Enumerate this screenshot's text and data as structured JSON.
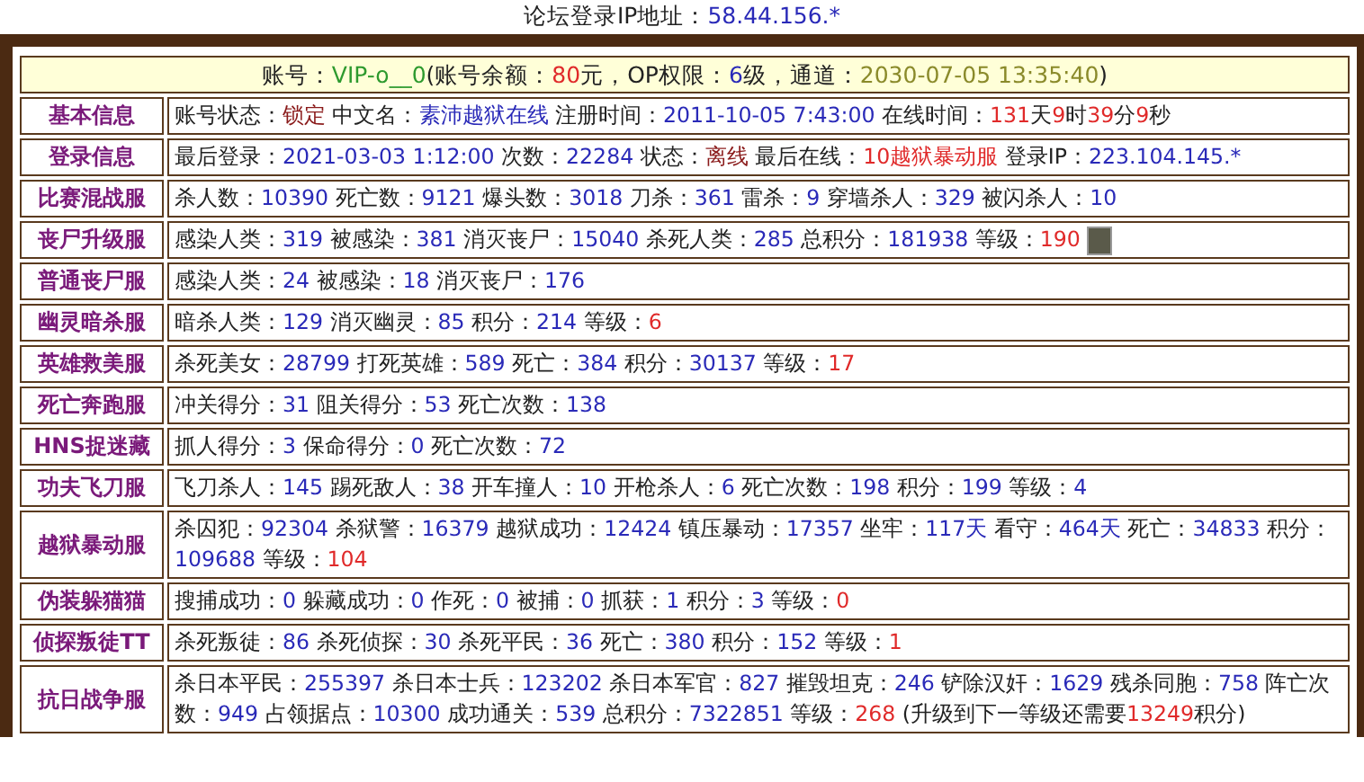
{
  "forum_ip": {
    "label": "论坛登录IP地址：",
    "value": "58.44.156.*"
  },
  "account_header": [
    {
      "text": "账号：",
      "kind": "plain"
    },
    {
      "text": "VIP-o__0",
      "kind": "account"
    },
    {
      "text": "(账号余额：",
      "kind": "plain"
    },
    {
      "text": "80",
      "kind": "level"
    },
    {
      "text": "元，OP权限：",
      "kind": "plain"
    },
    {
      "text": "6",
      "kind": "value"
    },
    {
      "text": "级，通道：",
      "kind": "plain"
    },
    {
      "text": "2030-07-05 13:35:40",
      "kind": "date"
    },
    {
      "text": ")",
      "kind": "plain"
    }
  ],
  "rows": [
    {
      "label": "基本信息",
      "parts": [
        {
          "text": "账号状态：",
          "kind": "plain"
        },
        {
          "text": "锁定",
          "kind": "status"
        },
        {
          "text": " 中文名：",
          "kind": "plain"
        },
        {
          "text": "素沛越狱在线",
          "kind": "value"
        },
        {
          "text": " 注册时间：",
          "kind": "plain"
        },
        {
          "text": "2011-10-05 7:43:00",
          "kind": "value"
        },
        {
          "text": " 在线时间：",
          "kind": "plain"
        },
        {
          "text": "131",
          "kind": "level"
        },
        {
          "text": "天",
          "kind": "plain"
        },
        {
          "text": "9",
          "kind": "level"
        },
        {
          "text": "时",
          "kind": "plain"
        },
        {
          "text": "39",
          "kind": "level"
        },
        {
          "text": "分",
          "kind": "plain"
        },
        {
          "text": "9",
          "kind": "level"
        },
        {
          "text": "秒",
          "kind": "plain"
        }
      ]
    },
    {
      "label": "登录信息",
      "parts": [
        {
          "text": "最后登录：",
          "kind": "plain"
        },
        {
          "text": "2021-03-03 1:12:00",
          "kind": "value"
        },
        {
          "text": " 次数：",
          "kind": "plain"
        },
        {
          "text": "22284",
          "kind": "value"
        },
        {
          "text": " 状态：",
          "kind": "plain"
        },
        {
          "text": "离线",
          "kind": "status"
        },
        {
          "text": " 最后在线：",
          "kind": "plain"
        },
        {
          "text": "10越狱暴动服",
          "kind": "level"
        },
        {
          "text": " 登录IP：",
          "kind": "plain"
        },
        {
          "text": "223.104.145.*",
          "kind": "value"
        }
      ]
    },
    {
      "label": "比赛混战服",
      "parts": [
        {
          "text": "杀人数：",
          "kind": "plain"
        },
        {
          "text": "10390",
          "kind": "value"
        },
        {
          "text": " 死亡数：",
          "kind": "plain"
        },
        {
          "text": "9121",
          "kind": "value"
        },
        {
          "text": " 爆头数：",
          "kind": "plain"
        },
        {
          "text": "3018",
          "kind": "value"
        },
        {
          "text": " 刀杀：",
          "kind": "plain"
        },
        {
          "text": "361",
          "kind": "value"
        },
        {
          "text": " 雷杀：",
          "kind": "plain"
        },
        {
          "text": "9",
          "kind": "value"
        },
        {
          "text": " 穿墙杀人：",
          "kind": "plain"
        },
        {
          "text": "329",
          "kind": "value"
        },
        {
          "text": " 被闪杀人：",
          "kind": "plain"
        },
        {
          "text": "10",
          "kind": "value"
        }
      ]
    },
    {
      "label": "丧尸升级服",
      "avatar": true,
      "parts": [
        {
          "text": "感染人类：",
          "kind": "plain"
        },
        {
          "text": "319",
          "kind": "value"
        },
        {
          "text": " 被感染：",
          "kind": "plain"
        },
        {
          "text": "381",
          "kind": "value"
        },
        {
          "text": " 消灭丧尸：",
          "kind": "plain"
        },
        {
          "text": "15040",
          "kind": "value"
        },
        {
          "text": " 杀死人类：",
          "kind": "plain"
        },
        {
          "text": "285",
          "kind": "value"
        },
        {
          "text": " 总积分：",
          "kind": "plain"
        },
        {
          "text": "181938",
          "kind": "value"
        },
        {
          "text": " 等级：",
          "kind": "plain"
        },
        {
          "text": "190",
          "kind": "level"
        }
      ]
    },
    {
      "label": "普通丧尸服",
      "parts": [
        {
          "text": "感染人类：",
          "kind": "plain"
        },
        {
          "text": "24",
          "kind": "value"
        },
        {
          "text": " 被感染：",
          "kind": "plain"
        },
        {
          "text": "18",
          "kind": "value"
        },
        {
          "text": " 消灭丧尸：",
          "kind": "plain"
        },
        {
          "text": "176",
          "kind": "value"
        }
      ]
    },
    {
      "label": "幽灵暗杀服",
      "parts": [
        {
          "text": "暗杀人类：",
          "kind": "plain"
        },
        {
          "text": "129",
          "kind": "value"
        },
        {
          "text": " 消灭幽灵：",
          "kind": "plain"
        },
        {
          "text": "85",
          "kind": "value"
        },
        {
          "text": " 积分：",
          "kind": "plain"
        },
        {
          "text": "214",
          "kind": "value"
        },
        {
          "text": " 等级：",
          "kind": "plain"
        },
        {
          "text": "6",
          "kind": "level"
        }
      ]
    },
    {
      "label": "英雄救美服",
      "parts": [
        {
          "text": "杀死美女：",
          "kind": "plain"
        },
        {
          "text": "28799",
          "kind": "value"
        },
        {
          "text": " 打死英雄：",
          "kind": "plain"
        },
        {
          "text": "589",
          "kind": "value"
        },
        {
          "text": " 死亡：",
          "kind": "plain"
        },
        {
          "text": "384",
          "kind": "value"
        },
        {
          "text": " 积分：",
          "kind": "plain"
        },
        {
          "text": "30137",
          "kind": "value"
        },
        {
          "text": " 等级：",
          "kind": "plain"
        },
        {
          "text": "17",
          "kind": "level"
        }
      ]
    },
    {
      "label": "死亡奔跑服",
      "parts": [
        {
          "text": "冲关得分：",
          "kind": "plain"
        },
        {
          "text": "31",
          "kind": "value"
        },
        {
          "text": " 阻关得分：",
          "kind": "plain"
        },
        {
          "text": "53",
          "kind": "value"
        },
        {
          "text": " 死亡次数：",
          "kind": "plain"
        },
        {
          "text": "138",
          "kind": "value"
        }
      ]
    },
    {
      "label": "HNS捉迷藏",
      "parts": [
        {
          "text": "抓人得分：",
          "kind": "plain"
        },
        {
          "text": "3",
          "kind": "value"
        },
        {
          "text": " 保命得分：",
          "kind": "plain"
        },
        {
          "text": "0",
          "kind": "value"
        },
        {
          "text": " 死亡次数：",
          "kind": "plain"
        },
        {
          "text": "72",
          "kind": "value"
        }
      ]
    },
    {
      "label": "功夫飞刀服",
      "parts": [
        {
          "text": "飞刀杀人：",
          "kind": "plain"
        },
        {
          "text": "145",
          "kind": "value"
        },
        {
          "text": " 踢死敌人：",
          "kind": "plain"
        },
        {
          "text": "38",
          "kind": "value"
        },
        {
          "text": " 开车撞人：",
          "kind": "plain"
        },
        {
          "text": "10",
          "kind": "value"
        },
        {
          "text": " 开枪杀人：",
          "kind": "plain"
        },
        {
          "text": "6",
          "kind": "value"
        },
        {
          "text": " 死亡次数：",
          "kind": "plain"
        },
        {
          "text": "198",
          "kind": "value"
        },
        {
          "text": " 积分：",
          "kind": "plain"
        },
        {
          "text": "199",
          "kind": "value"
        },
        {
          "text": " 等级：",
          "kind": "plain"
        },
        {
          "text": "4",
          "kind": "value"
        }
      ]
    },
    {
      "label": "越狱暴动服",
      "parts": [
        {
          "text": "杀囚犯：",
          "kind": "plain"
        },
        {
          "text": "92304",
          "kind": "value"
        },
        {
          "text": " 杀狱警：",
          "kind": "plain"
        },
        {
          "text": "16379",
          "kind": "value"
        },
        {
          "text": " 越狱成功：",
          "kind": "plain"
        },
        {
          "text": "12424",
          "kind": "value"
        },
        {
          "text": " 镇压暴动：",
          "kind": "plain"
        },
        {
          "text": "17357",
          "kind": "value"
        },
        {
          "text": " 坐牢：",
          "kind": "plain"
        },
        {
          "text": "117天",
          "kind": "value"
        },
        {
          "text": " 看守：",
          "kind": "plain"
        },
        {
          "text": "464天",
          "kind": "value"
        },
        {
          "text": " 死亡：",
          "kind": "plain"
        },
        {
          "text": "34833",
          "kind": "value"
        },
        {
          "text": " 积分：",
          "kind": "plain"
        },
        {
          "text": "109688",
          "kind": "value"
        },
        {
          "text": " 等级：",
          "kind": "plain"
        },
        {
          "text": "104",
          "kind": "level"
        }
      ]
    },
    {
      "label": "伪装躲猫猫",
      "parts": [
        {
          "text": "搜捕成功：",
          "kind": "plain"
        },
        {
          "text": "0",
          "kind": "value"
        },
        {
          "text": " 躲藏成功：",
          "kind": "plain"
        },
        {
          "text": "0",
          "kind": "value"
        },
        {
          "text": " 作死：",
          "kind": "plain"
        },
        {
          "text": "0",
          "kind": "value"
        },
        {
          "text": " 被捕：",
          "kind": "plain"
        },
        {
          "text": "0",
          "kind": "value"
        },
        {
          "text": " 抓获：",
          "kind": "plain"
        },
        {
          "text": "1",
          "kind": "value"
        },
        {
          "text": " 积分：",
          "kind": "plain"
        },
        {
          "text": "3",
          "kind": "value"
        },
        {
          "text": " 等级：",
          "kind": "plain"
        },
        {
          "text": "0",
          "kind": "level"
        }
      ]
    },
    {
      "label": "侦探叛徒TT",
      "parts": [
        {
          "text": "杀死叛徒：",
          "kind": "plain"
        },
        {
          "text": "86",
          "kind": "value"
        },
        {
          "text": " 杀死侦探：",
          "kind": "plain"
        },
        {
          "text": "30",
          "kind": "value"
        },
        {
          "text": " 杀死平民：",
          "kind": "plain"
        },
        {
          "text": "36",
          "kind": "value"
        },
        {
          "text": " 死亡：",
          "kind": "plain"
        },
        {
          "text": "380",
          "kind": "value"
        },
        {
          "text": " 积分：",
          "kind": "plain"
        },
        {
          "text": "152",
          "kind": "value"
        },
        {
          "text": " 等级：",
          "kind": "plain"
        },
        {
          "text": "1",
          "kind": "level"
        }
      ]
    },
    {
      "label": "抗日战争服",
      "parts": [
        {
          "text": "杀日本平民：",
          "kind": "plain"
        },
        {
          "text": "255397",
          "kind": "value"
        },
        {
          "text": " 杀日本士兵：",
          "kind": "plain"
        },
        {
          "text": "123202",
          "kind": "value"
        },
        {
          "text": " 杀日本军官：",
          "kind": "plain"
        },
        {
          "text": "827",
          "kind": "value"
        },
        {
          "text": " 摧毁坦克：",
          "kind": "plain"
        },
        {
          "text": "246",
          "kind": "value"
        },
        {
          "text": " 铲除汉奸：",
          "kind": "plain"
        },
        {
          "text": "1629",
          "kind": "value"
        },
        {
          "text": " 残杀同胞：",
          "kind": "plain"
        },
        {
          "text": "758",
          "kind": "value"
        },
        {
          "text": " 阵亡次数：",
          "kind": "plain"
        },
        {
          "text": "949",
          "kind": "value"
        },
        {
          "text": " 占领据点：",
          "kind": "plain"
        },
        {
          "text": "10300",
          "kind": "value"
        },
        {
          "text": " 成功通关：",
          "kind": "plain"
        },
        {
          "text": "539",
          "kind": "value"
        },
        {
          "text": " 总积分：",
          "kind": "plain"
        },
        {
          "text": "7322851",
          "kind": "value"
        },
        {
          "text": " 等级：",
          "kind": "plain"
        },
        {
          "text": "268",
          "kind": "level"
        },
        {
          "text": " (升级到下一等级还需要",
          "kind": "plain"
        },
        {
          "text": "13249",
          "kind": "level"
        },
        {
          "text": "积分)",
          "kind": "plain"
        }
      ]
    }
  ]
}
